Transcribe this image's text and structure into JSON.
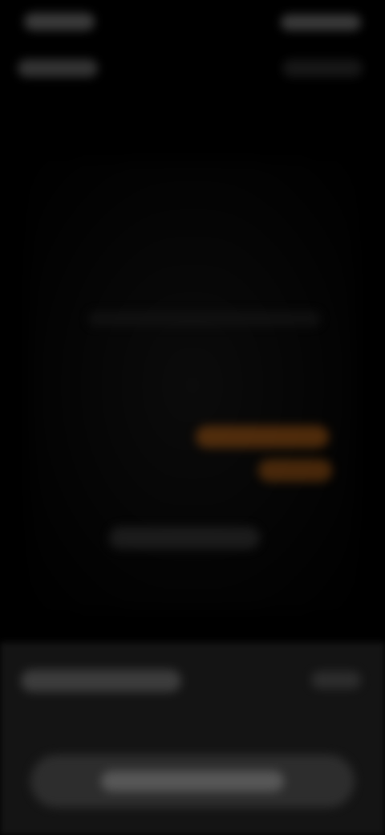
{
  "colors": {
    "background": "#000000",
    "accent_orange": "#8a4a10",
    "sheet_background": "#141414",
    "button_background": "#2f2f2f"
  },
  "status_bar": {
    "time": "",
    "carrier": ""
  },
  "overlay": {
    "headline": "",
    "accent_line_1": "",
    "accent_line_2": "",
    "secondary_line": ""
  },
  "bottom_sheet": {
    "title": "",
    "action_label": "",
    "primary_button_label": ""
  }
}
